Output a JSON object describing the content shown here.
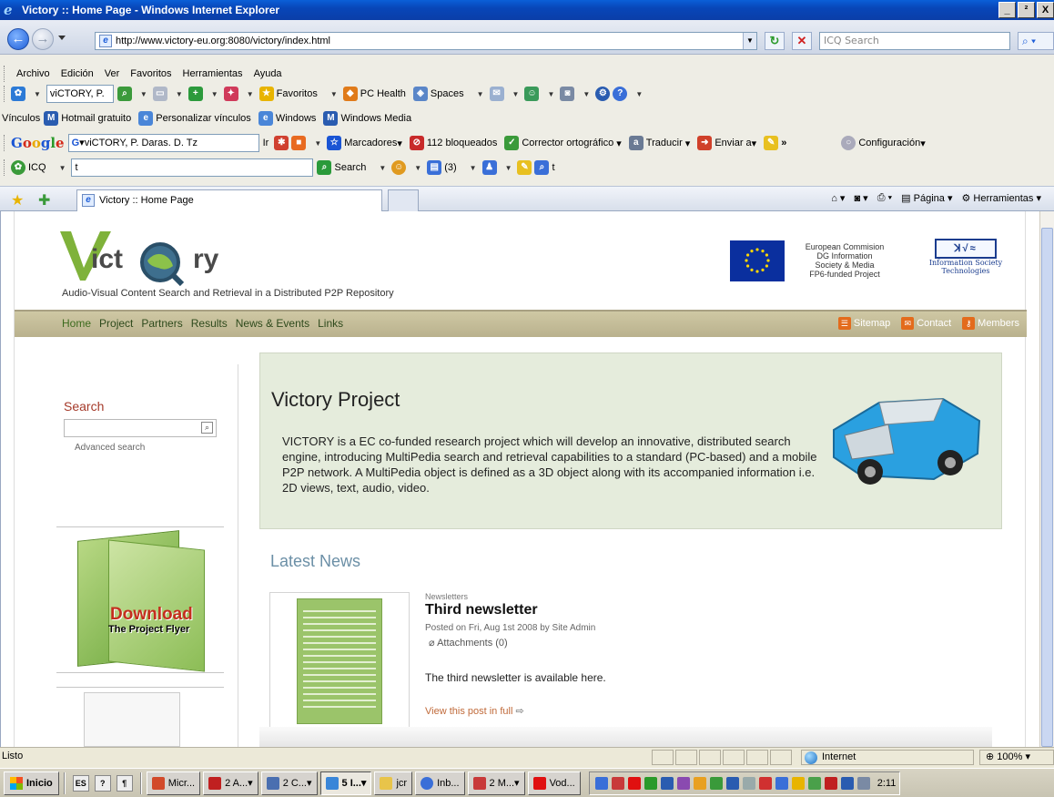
{
  "window": {
    "title": "Victory :: Home Page - Windows Internet Explorer",
    "controls": [
      "_",
      "²",
      "X"
    ]
  },
  "address_bar": {
    "url": "http://www.victory-eu.org:8080/victory/index.html",
    "search_placeholder": "ICQ Search"
  },
  "menu": [
    "Archivo",
    "Edición",
    "Ver",
    "Favoritos",
    "Herramientas",
    "Ayuda"
  ],
  "toolbar_msn": {
    "search_value": "viCTORY, P.",
    "items": [
      "Favoritos",
      "PC Health",
      "Spaces"
    ]
  },
  "links_bar": {
    "label": "Vínculos",
    "items": [
      "Hotmail gratuito",
      "Personalizar vínculos",
      "Windows",
      "Windows Media"
    ]
  },
  "google_bar": {
    "brand": "Google",
    "search_value": "viCTORY, P. Daras. D. Tz",
    "go_label": "Ir",
    "bookmarks": "Marcadores",
    "blocked": "112 bloqueados",
    "spellcheck": "Corrector ortográfico",
    "translate": "Traducir",
    "send": "Enviar a",
    "more": "»",
    "settings": "Configuración"
  },
  "icq_bar": {
    "label": "ICQ",
    "search_value": "t",
    "search_label": "Search",
    "count": "(3)",
    "t_label": "t"
  },
  "tab_bar": {
    "active_tab": "Victory :: Home Page",
    "commands": [
      "Página",
      "Herramientas"
    ]
  },
  "site": {
    "logo_text_a": "ict",
    "logo_text_b": "ry",
    "tagline": "Audio-Visual Content Search and Retrieval in a Distributed P2P Repository",
    "eu_text": [
      "European Commision",
      "DG Information",
      "Society & Media",
      "FP6-funded Project"
    ],
    "ist_box": "ꓘ√≈",
    "ist_label": [
      "Information Society",
      "Technologies"
    ],
    "nav": [
      "Home",
      "Project",
      "Partners",
      "Results",
      "News & Events",
      "Links"
    ],
    "nav_right": [
      "Sitemap",
      "Contact",
      "Members"
    ],
    "search_heading": "Search",
    "advanced_search": "Advanced search",
    "flyer_download": "Download",
    "flyer_sub": "The Project Flyer",
    "project_title": "Victory Project",
    "project_body": "VICTORY is a EC co-funded research project which will develop an innovative, distributed search engine, introducing MultiPedia search and retrieval capabilities to a standard (PC-based) and a mobile P2P network. A MultiPedia object is defined as a 3D object along with its accompanied information i.e. 2D views, text, audio, video.",
    "latest_news": "Latest News",
    "news": {
      "category": "Newsletters",
      "title": "Third newsletter",
      "meta": "Posted on Fri, Aug 1st 2008 by Site Admin",
      "attachments": "Attachments (0)",
      "text": "The third newsletter is available here.",
      "more": "View this post in full"
    }
  },
  "status_bar": {
    "text": "Listo",
    "zone": "Internet",
    "zoom": "100%"
  },
  "taskbar": {
    "start": "Inicio",
    "quick": [
      "ES",
      "?",
      "¶"
    ],
    "tasks": [
      "Micr...",
      "2 A...",
      "2 C...",
      "5 I...",
      "jcr",
      "Inb...",
      "2 M...",
      "Vod..."
    ],
    "active_task_index": 3,
    "clock": "2:11"
  },
  "colors": {
    "nav_bg": "#c3bb97",
    "project_bg": "#e5ecdc",
    "news_heading": "#6b8fa6",
    "search_heading": "#a53a2a",
    "download_red": "#c42f1e"
  }
}
